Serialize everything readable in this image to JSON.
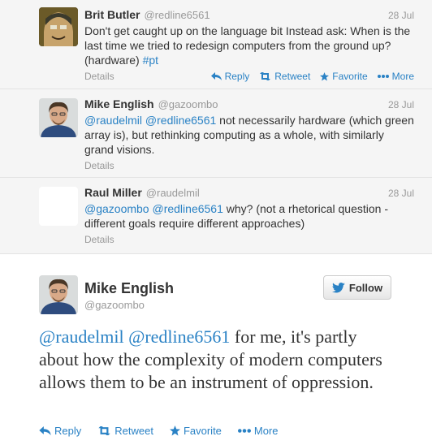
{
  "tweets": [
    {
      "name": "Brit Butler",
      "handle": "@redline6561",
      "time": "28 Jul",
      "text_plain": "Don't get caught up on the language bit Instead ask: When is the last time we tried to redesign computers from the ground up? (hardware) ",
      "hashtag": "#pt",
      "details": "Details",
      "reply": "Reply",
      "retweet": "Retweet",
      "favorite": "Favorite",
      "more": "More"
    },
    {
      "name": "Mike English",
      "handle": "@gazoombo",
      "time": "28 Jul",
      "mention1": "@raudelmil",
      "mention2": "@redline6561",
      "text_plain": " not necessarily hardware (which green array is), but rethinking computing as a whole, with similarly grand visions.",
      "details": "Details"
    },
    {
      "name": "Raul Miller",
      "handle": "@raudelmil",
      "time": "28 Jul",
      "mention1": "@gazoombo",
      "mention2": "@redline6561",
      "text_plain": " why? (not a rhetorical question - different goals require different approaches)",
      "details": "Details"
    }
  ],
  "focused": {
    "name": "Mike English",
    "handle": "@gazoombo",
    "follow": "Follow",
    "mention1": "@raudelmil",
    "mention2": "@redline6561",
    "text_plain": " for me, it's partly about how the complexity of modern computers allows them to be an instrument of oppression.",
    "reply": "Reply",
    "retweet": "Retweet",
    "favorite": "Favorite",
    "more": "More"
  },
  "colors": {
    "link": "#2a82c5",
    "twitter_blue": "#2a82c5"
  }
}
